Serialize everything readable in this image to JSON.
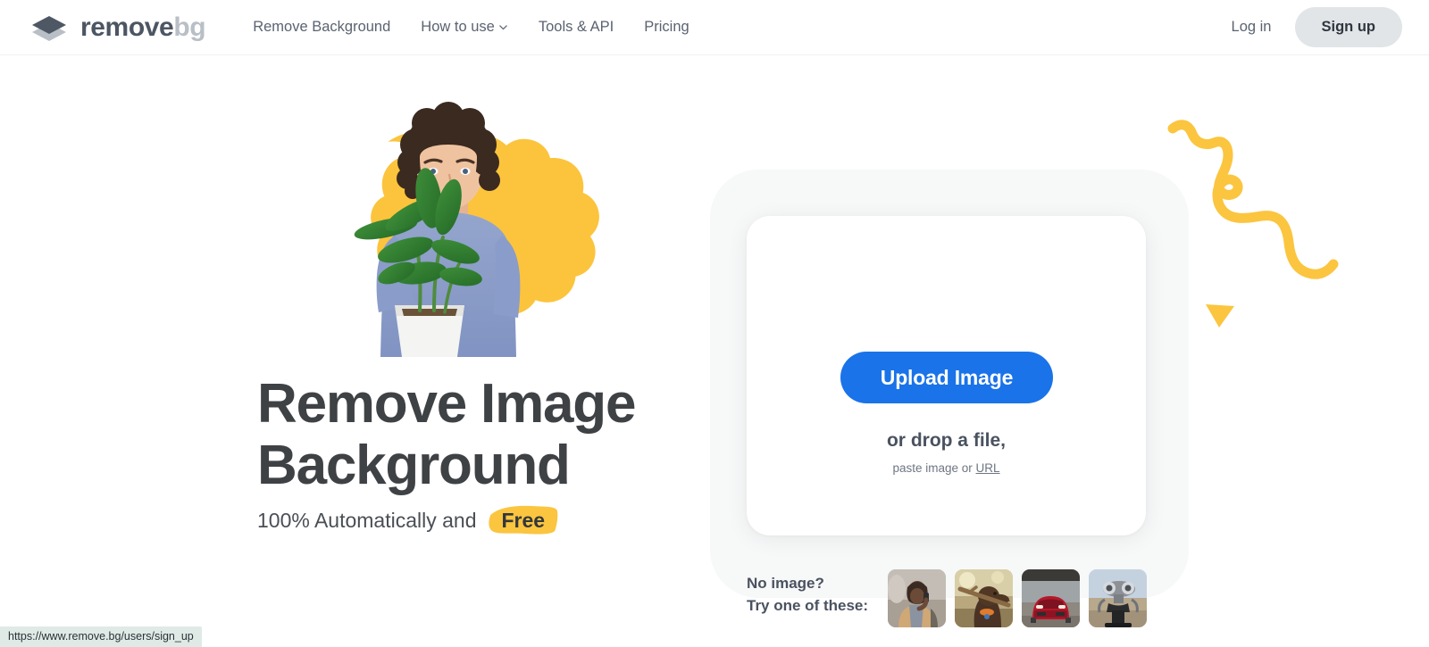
{
  "header": {
    "logo": {
      "word_dark": "remove",
      "word_light": "bg",
      "icon": "layers-diamond-icon"
    },
    "nav": [
      {
        "label": "Remove Background",
        "icon": null
      },
      {
        "label": "How to use",
        "icon": "chevron-down-icon"
      },
      {
        "label": "Tools & API",
        "icon": null
      },
      {
        "label": "Pricing",
        "icon": null
      }
    ],
    "login_label": "Log in",
    "signup_label": "Sign up"
  },
  "hero": {
    "headline_line1": "Remove Image",
    "headline_line2": "Background",
    "subline_prefix": "100% Automatically and",
    "subline_highlight": "Free",
    "image_alt": "man-holding-plant-photo"
  },
  "upload": {
    "button_label": "Upload Image",
    "drop_label": "or drop a file,",
    "paste_prefix": "paste image or ",
    "paste_link_label": "URL"
  },
  "samples": {
    "label_line1": "No image?",
    "label_line2": "Try one of these:",
    "thumbs": [
      {
        "name": "sample-thumb-man-on-phone"
      },
      {
        "name": "sample-thumb-dog-with-stick"
      },
      {
        "name": "sample-thumb-red-car"
      },
      {
        "name": "sample-thumb-binoculars"
      }
    ]
  },
  "decor": {
    "squiggle": "yellow-squiggle-decoration",
    "triangle": "yellow-triangle-decoration"
  },
  "status_bar": {
    "url": "https://www.remove.bg/users/sign_up"
  },
  "colors": {
    "accent_blue": "#1a73e8",
    "accent_yellow": "#fbc53f",
    "logo_dark": "#4c5663",
    "logo_light": "#b9bfc6",
    "heading": "#3f4245",
    "signup_bg": "#e2e5e7",
    "panel_bg": "#f7f8f8",
    "status_bg": "#dfeae6"
  }
}
